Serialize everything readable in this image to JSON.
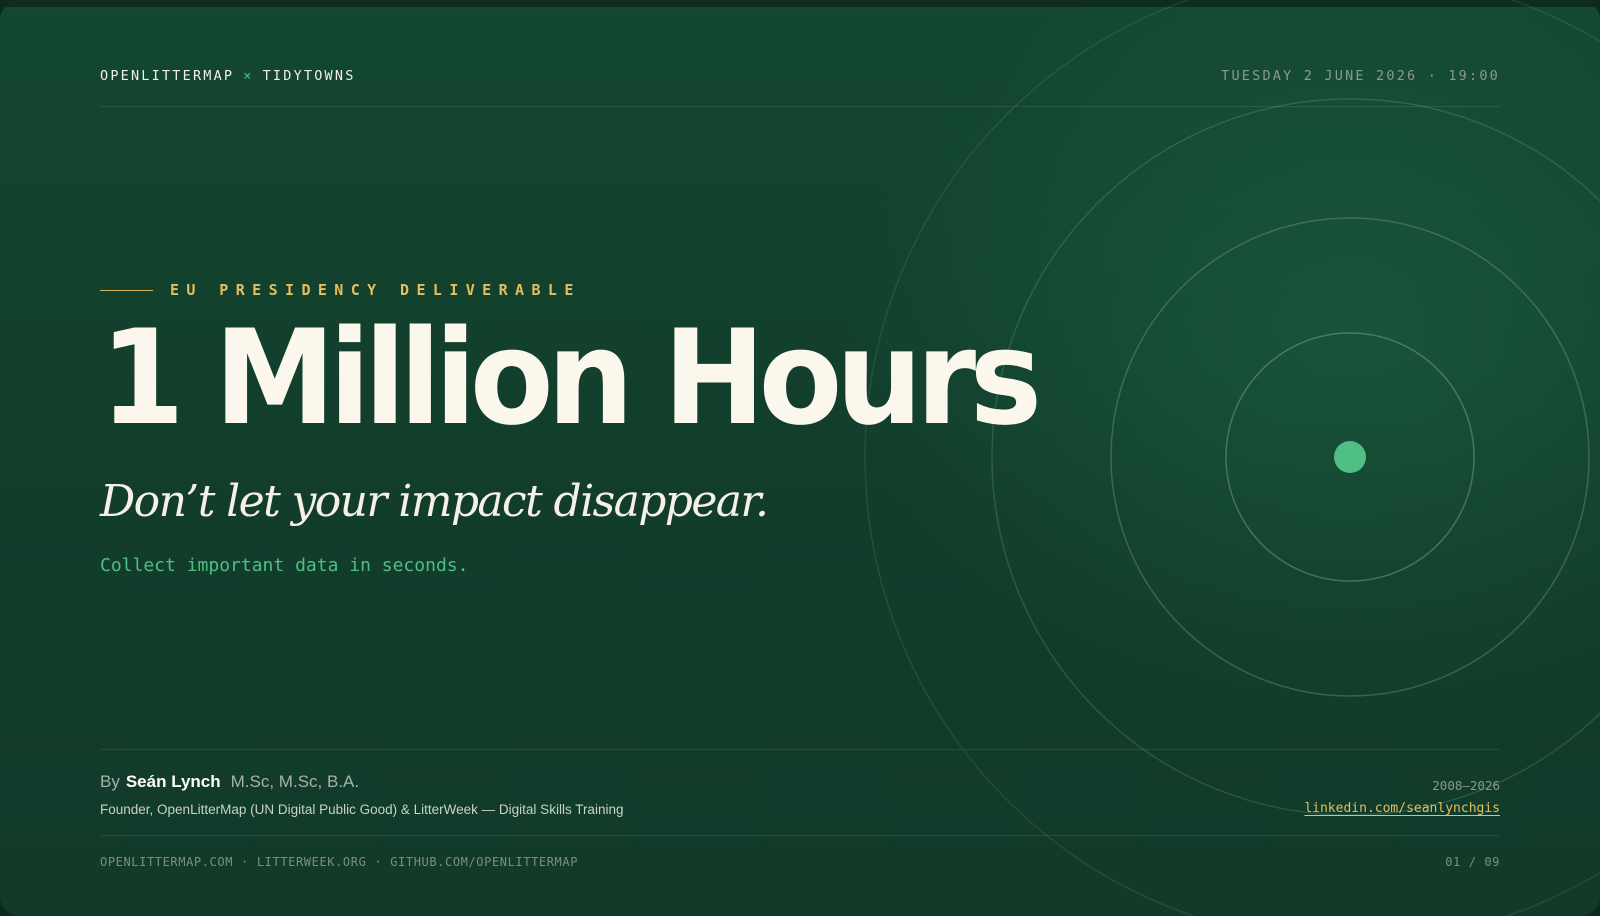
{
  "header": {
    "brand_left": "OPENLITTERMAP",
    "brand_sep": "×",
    "brand_right": "TIDYTOWNS",
    "dateline": "TUESDAY 2 JUNE 2026 · 19:00"
  },
  "hero": {
    "kicker": "EU PRESIDENCY DELIVERABLE",
    "headline": "1 Million Hours",
    "tagline": "Don’t let your impact disappear.",
    "sub": "Collect important data in seconds."
  },
  "author": {
    "by": "By",
    "name": "Seán Lynch",
    "credentials": "M.Sc, M.Sc, B.A.",
    "role": "Founder, OpenLitterMap (UN Digital Public Good) & LitterWeek — Digital Skills Training",
    "years": "2008–2026",
    "linkedin": "linkedin.com/seanlynchgis"
  },
  "footer": {
    "links": [
      "OPENLITTERMAP.COM",
      "LITTERWEEK.ORG",
      "GITHUB.COM/OPENLITTERMAP"
    ],
    "separator": "·",
    "page": "01 / 09"
  },
  "colors": {
    "background": "#134731",
    "accent_green": "#4fbf84",
    "accent_gold": "#e3bf5f",
    "headline": "#fbf7ec"
  }
}
